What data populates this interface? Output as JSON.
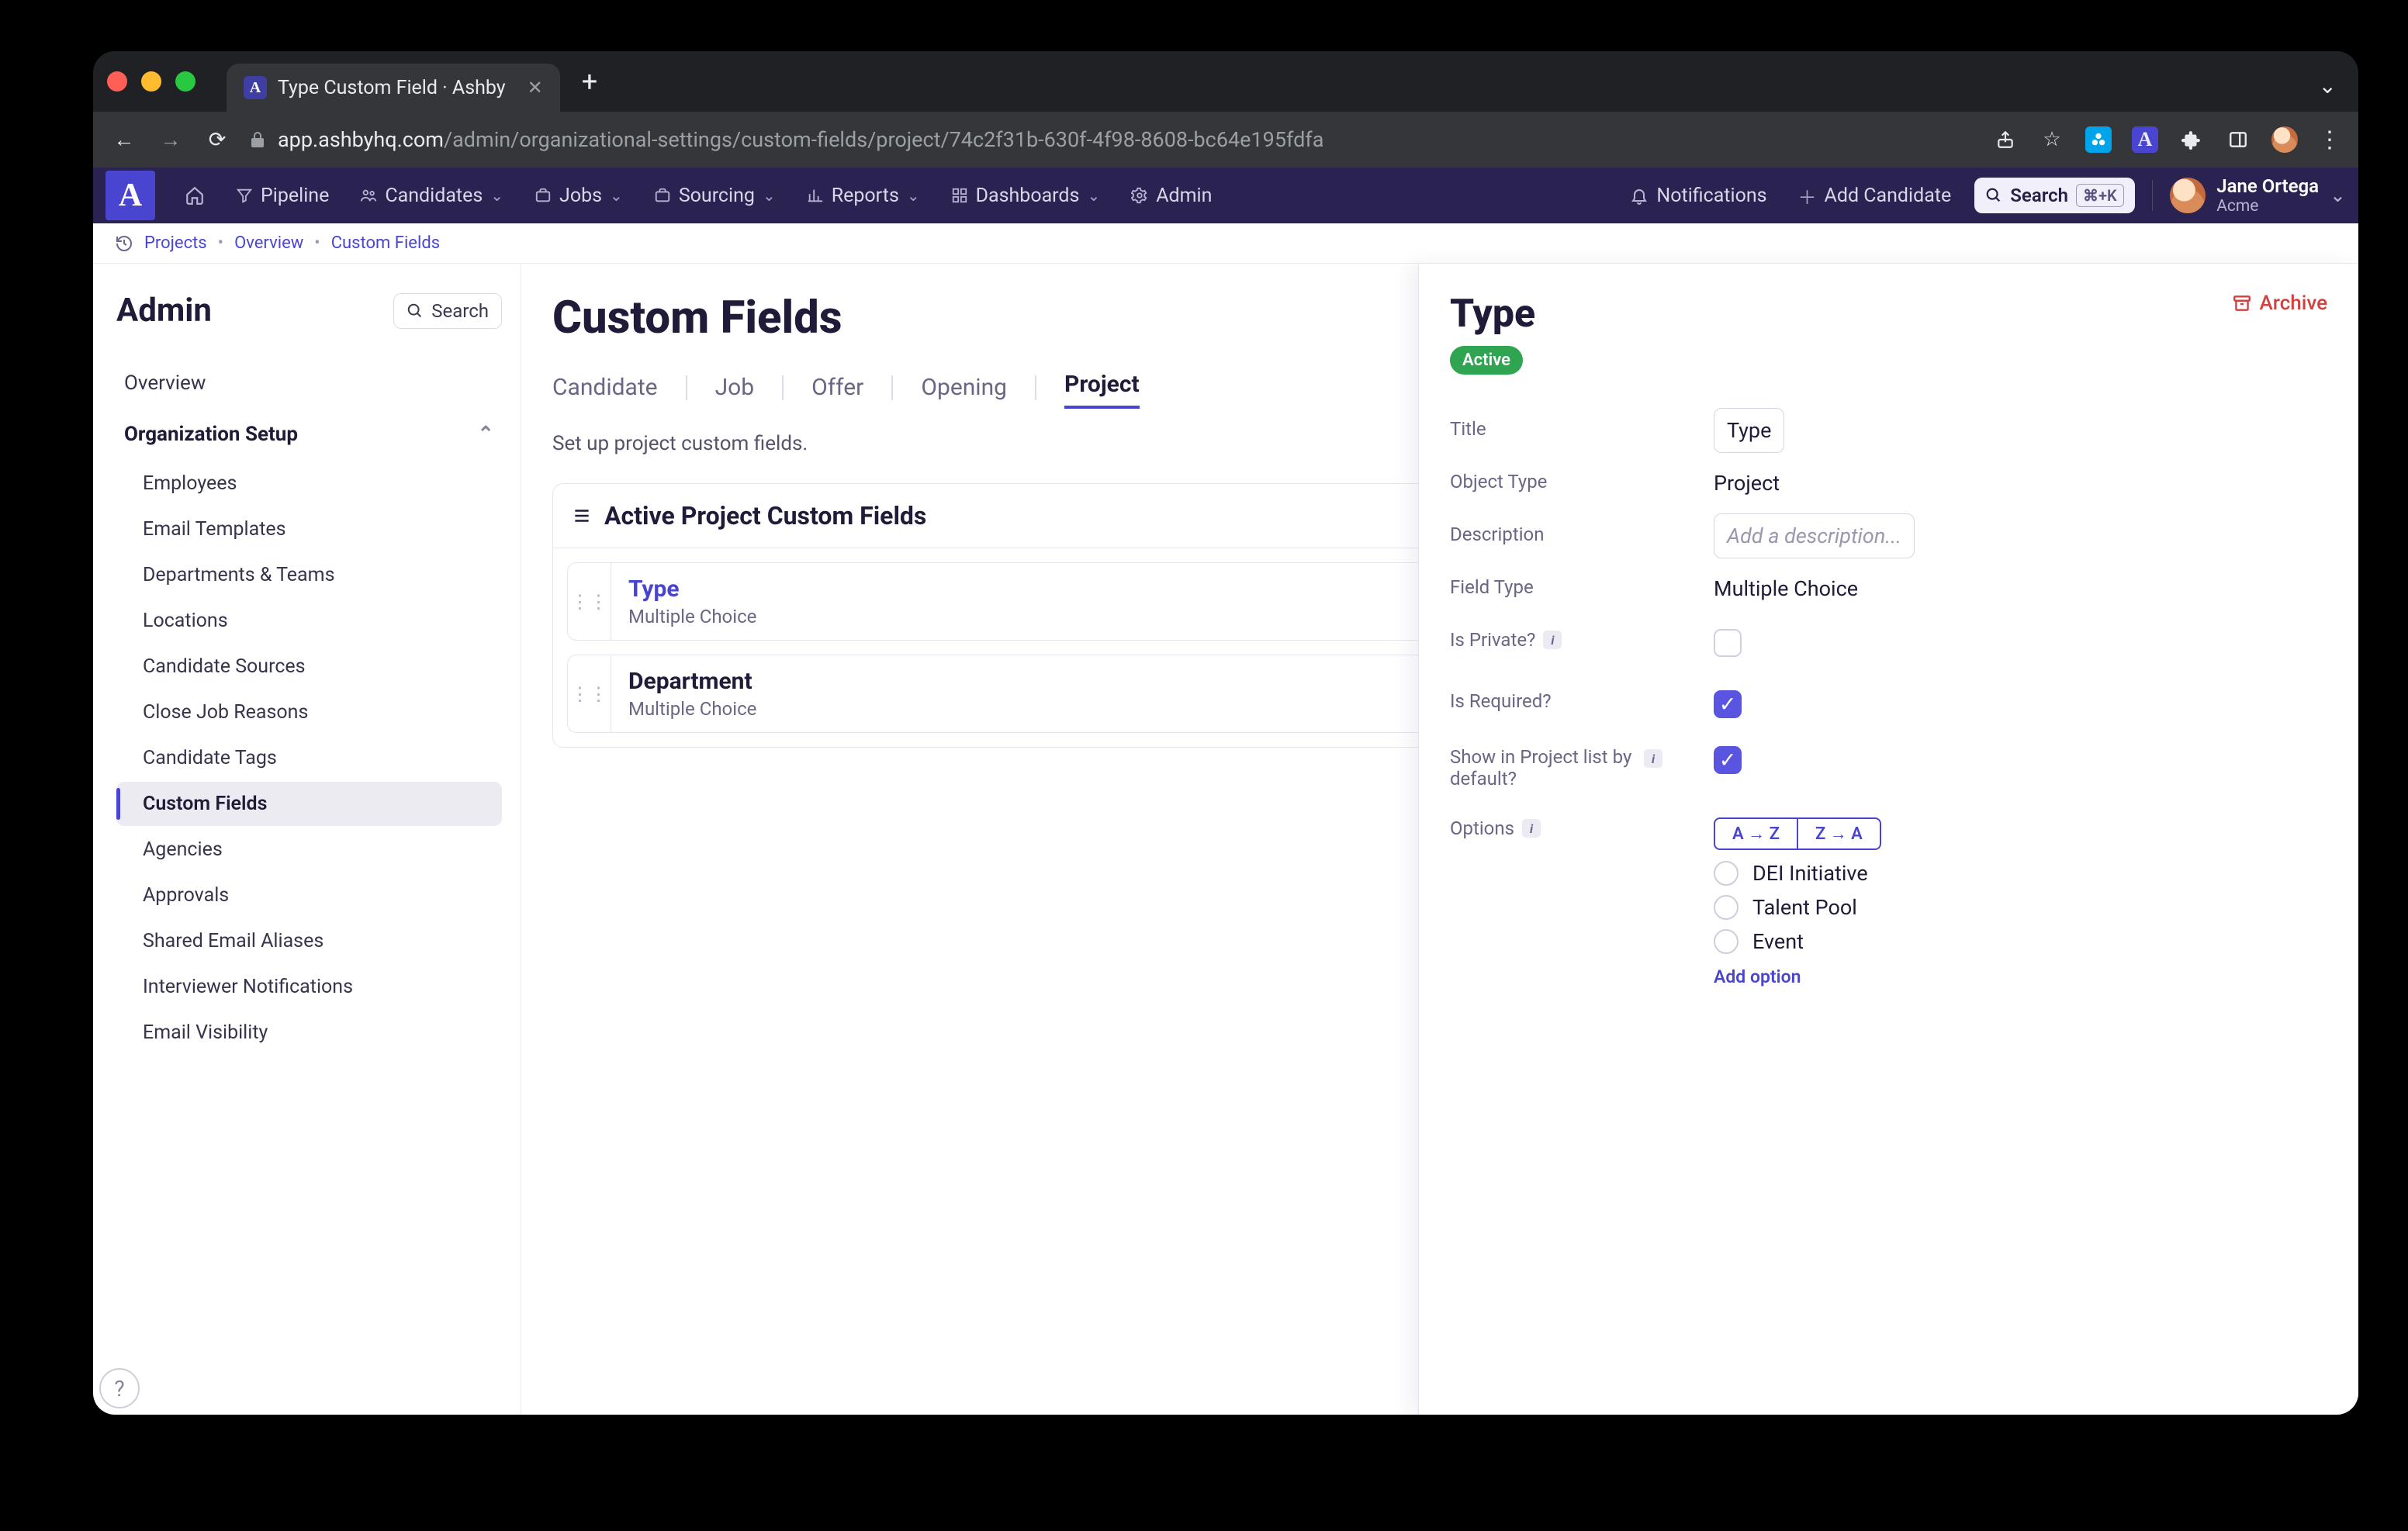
{
  "browser": {
    "tab_title": "Type Custom Field · Ashby",
    "url_host": "app.ashbyhq.com",
    "url_path": "/admin/organizational-settings/custom-fields/project/74c2f31b-630f-4f98-8608-bc64e195fdfa"
  },
  "topnav": {
    "items": [
      {
        "label": "Pipeline",
        "icon": "funnel",
        "dropdown": false
      },
      {
        "label": "Candidates",
        "icon": "people",
        "dropdown": true
      },
      {
        "label": "Jobs",
        "icon": "briefcase",
        "dropdown": true
      },
      {
        "label": "Sourcing",
        "icon": "briefcase",
        "dropdown": true
      },
      {
        "label": "Reports",
        "icon": "chart",
        "dropdown": true
      },
      {
        "label": "Dashboards",
        "icon": "grid",
        "dropdown": true
      },
      {
        "label": "Admin",
        "icon": "gear",
        "dropdown": false
      }
    ],
    "notifications": "Notifications",
    "add_candidate": "Add Candidate",
    "search_label": "Search",
    "search_kbd": "⌘+K",
    "user": {
      "name": "Jane Ortega",
      "org": "Acme"
    }
  },
  "breadcrumbs": [
    "Projects",
    "Overview",
    "Custom Fields"
  ],
  "sidebar": {
    "title": "Admin",
    "search_label": "Search",
    "overview": "Overview",
    "group_label": "Organization Setup",
    "items": [
      "Employees",
      "Email Templates",
      "Departments & Teams",
      "Locations",
      "Candidate Sources",
      "Close Job Reasons",
      "Candidate Tags",
      "Custom Fields",
      "Agencies",
      "Approvals",
      "Shared Email Aliases",
      "Interviewer Notifications",
      "Email Visibility"
    ],
    "active_index": 7
  },
  "main": {
    "title": "Custom Fields",
    "subtitle": "Set up project custom fields.",
    "tabs": [
      "Candidate",
      "Job",
      "Offer",
      "Opening",
      "Project"
    ],
    "active_tab": 4,
    "card_title": "Active Project Custom Fields",
    "rows": [
      {
        "title": "Type",
        "subtitle": "Multiple Choice",
        "selected": true
      },
      {
        "title": "Department",
        "subtitle": "Multiple Choice",
        "selected": false
      }
    ]
  },
  "detail": {
    "title": "Type",
    "archive_label": "Archive",
    "status_badge": "Active",
    "labels": {
      "title": "Title",
      "object_type": "Object Type",
      "description": "Description",
      "field_type": "Field Type",
      "is_private": "Is Private?",
      "is_required": "Is Required?",
      "show_in_list": "Show in Project list by default?",
      "options": "Options"
    },
    "values": {
      "title": "Type",
      "object_type": "Project",
      "description_placeholder": "Add a description...",
      "field_type": "Multiple Choice",
      "is_private": false,
      "is_required": true,
      "show_in_list": true,
      "sort_az": "A → Z",
      "sort_za": "Z → A",
      "options": [
        "DEI Initiative",
        "Talent Pool",
        "Event"
      ],
      "add_option": "Add option"
    }
  }
}
